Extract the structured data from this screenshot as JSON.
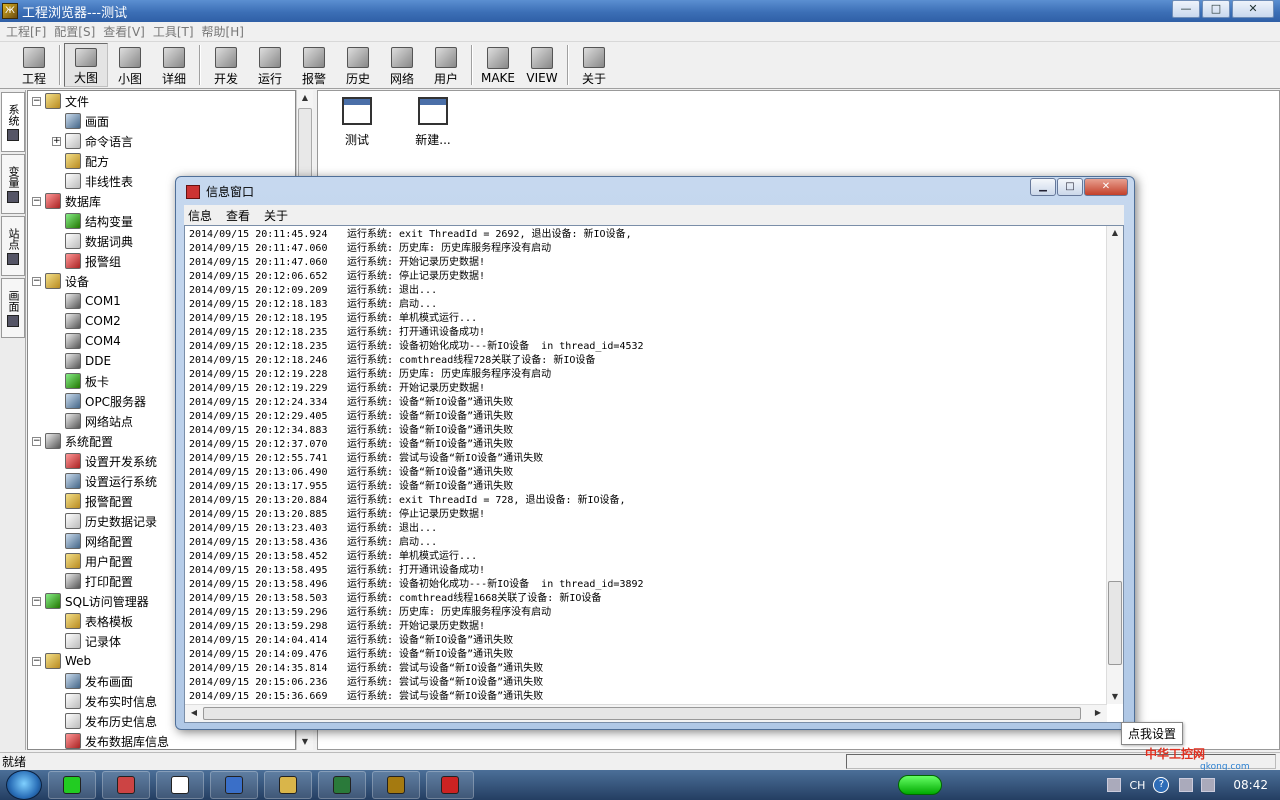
{
  "window": {
    "title": "工程浏览器---测试",
    "min": "—",
    "max": "□",
    "close": "✕"
  },
  "menubar": [
    "工程[F]",
    "配置[S]",
    "查看[V]",
    "工具[T]",
    "帮助[H]"
  ],
  "toolbar": [
    {
      "label": "工程",
      "icon": "project-icon"
    },
    {
      "sep": true
    },
    {
      "label": "大图",
      "icon": "large-icons-view-icon",
      "active": true
    },
    {
      "label": "小图",
      "icon": "small-icons-view-icon"
    },
    {
      "label": "详细",
      "icon": "details-view-icon"
    },
    {
      "sep": true
    },
    {
      "label": "开发",
      "icon": "develop-icon"
    },
    {
      "label": "运行",
      "icon": "run-icon"
    },
    {
      "label": "报警",
      "icon": "alarm-icon"
    },
    {
      "label": "历史",
      "icon": "history-icon"
    },
    {
      "label": "网络",
      "icon": "network-icon"
    },
    {
      "label": "用户",
      "icon": "user-icon"
    },
    {
      "sep": true
    },
    {
      "label": "MAKE",
      "icon": "make-icon"
    },
    {
      "label": "VIEW",
      "icon": "view-icon"
    },
    {
      "sep": true
    },
    {
      "label": "关于",
      "icon": "about-icon"
    }
  ],
  "vtabs": [
    "系统",
    "变量",
    "站点",
    "画面"
  ],
  "tree": [
    {
      "label": "文件",
      "level": 0,
      "toggle": "−",
      "kind": "folder"
    },
    {
      "label": "画面",
      "level": 1,
      "kind": "blue"
    },
    {
      "label": "命令语言",
      "level": 1,
      "toggle": "+",
      "kind": "doc"
    },
    {
      "label": "配方",
      "level": 1,
      "kind": "folder"
    },
    {
      "label": "非线性表",
      "level": 1,
      "kind": "doc"
    },
    {
      "label": "数据库",
      "level": 0,
      "toggle": "−",
      "kind": "red"
    },
    {
      "label": "结构变量",
      "level": 1,
      "kind": "green"
    },
    {
      "label": "数据词典",
      "level": 1,
      "kind": "doc"
    },
    {
      "label": "报警组",
      "level": 1,
      "kind": "red"
    },
    {
      "label": "设备",
      "level": 0,
      "toggle": "−",
      "kind": "folder"
    },
    {
      "label": "COM1",
      "level": 1,
      "kind": "dev"
    },
    {
      "label": "COM2",
      "level": 1,
      "kind": "dev"
    },
    {
      "label": "COM4",
      "level": 1,
      "kind": "dev"
    },
    {
      "label": "DDE",
      "level": 1,
      "kind": "dev"
    },
    {
      "label": "板卡",
      "level": 1,
      "kind": "green"
    },
    {
      "label": "OPC服务器",
      "level": 1,
      "kind": "blue"
    },
    {
      "label": "网络站点",
      "level": 1,
      "kind": "dev"
    },
    {
      "label": "系统配置",
      "level": 0,
      "toggle": "−",
      "kind": "dev"
    },
    {
      "label": "设置开发系统",
      "level": 1,
      "kind": "red"
    },
    {
      "label": "设置运行系统",
      "level": 1,
      "kind": "blue"
    },
    {
      "label": "报警配置",
      "level": 1,
      "kind": "folder"
    },
    {
      "label": "历史数据记录",
      "level": 1,
      "kind": "doc"
    },
    {
      "label": "网络配置",
      "level": 1,
      "kind": "blue"
    },
    {
      "label": "用户配置",
      "level": 1,
      "kind": "folder"
    },
    {
      "label": "打印配置",
      "level": 1,
      "kind": "dev"
    },
    {
      "label": "SQL访问管理器",
      "level": 0,
      "toggle": "−",
      "kind": "green"
    },
    {
      "label": "表格模板",
      "level": 1,
      "kind": "folder"
    },
    {
      "label": "记录体",
      "level": 1,
      "kind": "doc"
    },
    {
      "label": "Web",
      "level": 0,
      "toggle": "−",
      "kind": "folder"
    },
    {
      "label": "发布画面",
      "level": 1,
      "kind": "blue"
    },
    {
      "label": "发布实时信息",
      "level": 1,
      "kind": "doc"
    },
    {
      "label": "发布历史信息",
      "level": 1,
      "kind": "doc"
    },
    {
      "label": "发布数据库信息",
      "level": 1,
      "kind": "red"
    }
  ],
  "main_icons": [
    {
      "label": "测试",
      "icon": "screen-file-icon"
    },
    {
      "label": "新建...",
      "icon": "new-screen-icon"
    }
  ],
  "info_window": {
    "title": "信息窗口",
    "menu": [
      "信息",
      "查看",
      "关于"
    ],
    "log": [
      [
        "2014/09/15 20:11:45.924",
        "运行系统: exit ThreadId = 2692, 退出设备: 新IO设备,"
      ],
      [
        "2014/09/15 20:11:47.060",
        "运行系统: 历史库: 历史库服务程序没有启动"
      ],
      [
        "2014/09/15 20:11:47.060",
        "运行系统: 开始记录历史数据!"
      ],
      [
        "2014/09/15 20:12:06.652",
        "运行系统: 停止记录历史数据!"
      ],
      [
        "2014/09/15 20:12:09.209",
        "运行系统: 退出..."
      ],
      [
        "2014/09/15 20:12:18.183",
        "运行系统: 启动..."
      ],
      [
        "2014/09/15 20:12:18.195",
        "运行系统: 单机模式运行..."
      ],
      [
        "2014/09/15 20:12:18.235",
        "运行系统: 打开通讯设备成功!"
      ],
      [
        "2014/09/15 20:12:18.235",
        "运行系统: 设备初始化成功---新IO设备  in thread_id=4532"
      ],
      [
        "2014/09/15 20:12:18.246",
        "运行系统: comthread线程728关联了设备: 新IO设备"
      ],
      [
        "2014/09/15 20:12:19.228",
        "运行系统: 历史库: 历史库服务程序没有启动"
      ],
      [
        "2014/09/15 20:12:19.229",
        "运行系统: 开始记录历史数据!"
      ],
      [
        "2014/09/15 20:12:24.334",
        "运行系统: 设备“新IO设备”通讯失败"
      ],
      [
        "2014/09/15 20:12:29.405",
        "运行系统: 设备“新IO设备”通讯失败"
      ],
      [
        "2014/09/15 20:12:34.883",
        "运行系统: 设备“新IO设备”通讯失败"
      ],
      [
        "2014/09/15 20:12:37.070",
        "运行系统: 设备“新IO设备”通讯失败"
      ],
      [
        "2014/09/15 20:12:55.741",
        "运行系统: 尝试与设备“新IO设备”通讯失败"
      ],
      [
        "2014/09/15 20:13:06.490",
        "运行系统: 设备“新IO设备”通讯失败"
      ],
      [
        "2014/09/15 20:13:17.955",
        "运行系统: 设备“新IO设备”通讯失败"
      ],
      [
        "2014/09/15 20:13:20.884",
        "运行系统: exit ThreadId = 728, 退出设备: 新IO设备,"
      ],
      [
        "2014/09/15 20:13:20.885",
        "运行系统: 停止记录历史数据!"
      ],
      [
        "2014/09/15 20:13:23.403",
        "运行系统: 退出..."
      ],
      [
        "2014/09/15 20:13:58.436",
        "运行系统: 启动..."
      ],
      [
        "2014/09/15 20:13:58.452",
        "运行系统: 单机模式运行..."
      ],
      [
        "2014/09/15 20:13:58.495",
        "运行系统: 打开通讯设备成功!"
      ],
      [
        "2014/09/15 20:13:58.496",
        "运行系统: 设备初始化成功---新IO设备  in thread_id=3892"
      ],
      [
        "2014/09/15 20:13:58.503",
        "运行系统: comthread线程1668关联了设备: 新IO设备"
      ],
      [
        "2014/09/15 20:13:59.296",
        "运行系统: 历史库: 历史库服务程序没有启动"
      ],
      [
        "2014/09/15 20:13:59.298",
        "运行系统: 开始记录历史数据!"
      ],
      [
        "2014/09/15 20:14:04.414",
        "运行系统: 设备“新IO设备”通讯失败"
      ],
      [
        "2014/09/15 20:14:09.476",
        "运行系统: 设备“新IO设备”通讯失败"
      ],
      [
        "2014/09/15 20:14:35.814",
        "运行系统: 尝试与设备“新IO设备”通讯失败"
      ],
      [
        "2014/09/15 20:15:06.236",
        "运行系统: 尝试与设备“新IO设备”通讯失败"
      ],
      [
        "2014/09/15 20:15:36.669",
        "运行系统: 尝试与设备“新IO设备”通讯失败"
      ]
    ]
  },
  "tooltip": "点我设置",
  "status": "就绪",
  "taskbar": {
    "apps": [
      "green-app-icon",
      "chrome-icon",
      "bluetooth-icon",
      "browser-icon",
      "explorer-icon",
      "excel-icon",
      "kingview-icon",
      "info-app-icon"
    ],
    "lang": "CH",
    "help": "?",
    "time": "08:42"
  },
  "watermark": {
    "brand": "中华工控网",
    "url": "gkong.com"
  },
  "colors": {
    "titlebar": "#3c6fb6",
    "taskbar": "#243e62",
    "log_bg": "#ffffff"
  }
}
